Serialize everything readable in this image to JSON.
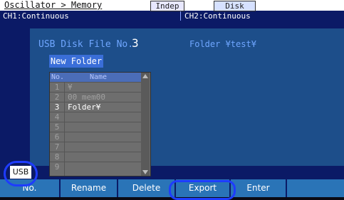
{
  "header": {
    "breadcrumb": "Oscillator > Memory",
    "mode_chip": "Indep",
    "storage_chip": "Disk"
  },
  "channels": {
    "ch1": "CH1:Continuous",
    "ch2": "CH2:Continuous"
  },
  "main": {
    "file_no_label": "USB Disk File No.",
    "file_no_value": "3",
    "folder_label": "Folder ¥test¥",
    "new_folder_button": "New Folder"
  },
  "file_list": {
    "columns": [
      "No.",
      "Name"
    ],
    "rows": [
      {
        "no": "1",
        "name": "¥"
      },
      {
        "no": "2",
        "name": "00 mem00"
      },
      {
        "no": "3",
        "name": "Folder¥"
      },
      {
        "no": "4",
        "name": ""
      },
      {
        "no": "5",
        "name": ""
      },
      {
        "no": "6",
        "name": ""
      },
      {
        "no": "7",
        "name": ""
      },
      {
        "no": "8",
        "name": ""
      },
      {
        "no": "9",
        "name": ""
      }
    ],
    "selected_no": "3"
  },
  "softkeys": {
    "k1": "No.",
    "k2": "Rename",
    "k3": "Delete",
    "k4": "Export",
    "k5": "Enter",
    "k6": ""
  },
  "usb_label": "USB",
  "colors": {
    "background": "#0b1a66",
    "panel": "#1d4e8a",
    "accent": "#3a6ed8",
    "highlight_ring": "#1e3cff"
  }
}
